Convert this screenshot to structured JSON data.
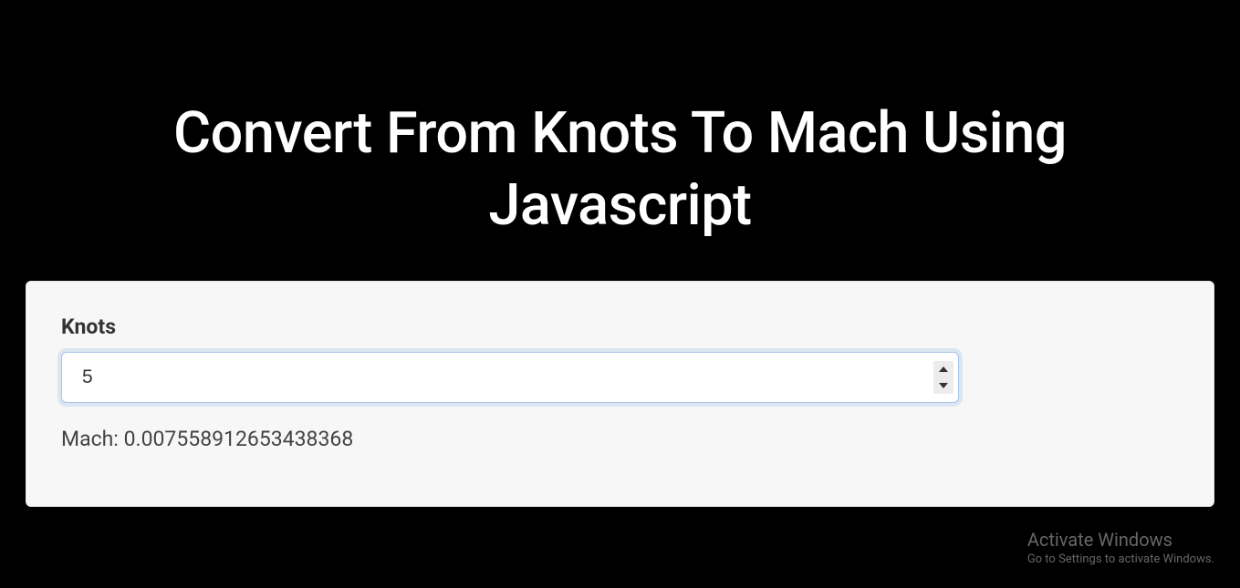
{
  "header": {
    "title": "Convert From Knots To Mach Using Javascript"
  },
  "form": {
    "input_label": "Knots",
    "input_value": "5",
    "result_label": "Mach: ",
    "result_value": "0.007558912653438368"
  },
  "watermark": {
    "title": "Activate Windows",
    "subtitle": "Go to Settings to activate Windows."
  }
}
